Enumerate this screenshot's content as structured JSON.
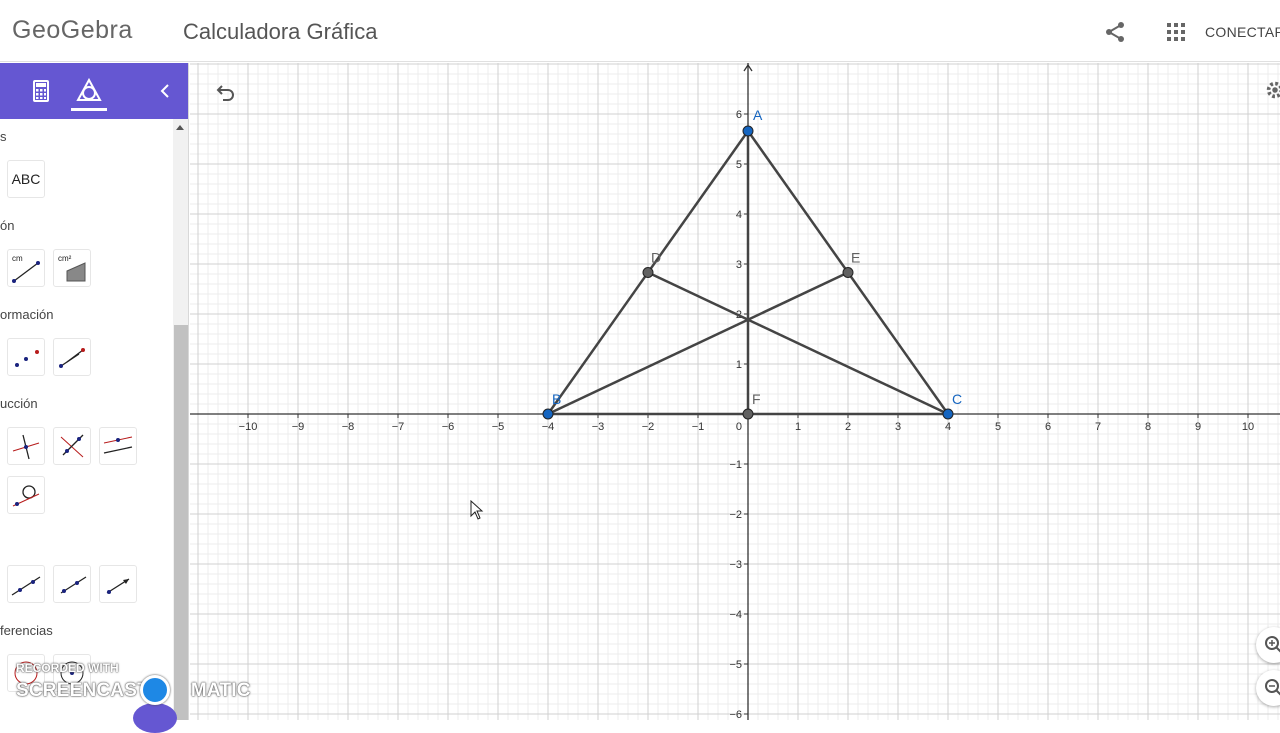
{
  "header": {
    "logo": "GeoGebra",
    "title": "Calculadora Gráfica",
    "connect_label": "CONECTAR",
    "icons": [
      "share-icon",
      "apps-grid-icon"
    ]
  },
  "sidebar": {
    "tabs": [
      "calculator-icon",
      "geometry-tools-icon"
    ],
    "categories": [
      "s",
      "ón",
      "ormación",
      "ucción",
      "ferencias"
    ],
    "tools": {
      "text": "ABC",
      "distance_unit": "cm",
      "area_unit": "cm²"
    }
  },
  "graphics": {
    "x_ticks": [
      "−10",
      "−9",
      "−8",
      "−7",
      "−6",
      "−5",
      "−4",
      "−3",
      "−2",
      "−1",
      "1",
      "2",
      "3",
      "4",
      "5",
      "6",
      "7",
      "8",
      "9",
      "10"
    ],
    "y_ticks": [
      "6",
      "5",
      "4",
      "3",
      "2",
      "1",
      "−1",
      "−2",
      "−3",
      "−4",
      "−5",
      "−6"
    ],
    "origin_label": "0",
    "points": [
      {
        "name": "A",
        "x": 0,
        "y": 5.66,
        "color": "#1565c0"
      },
      {
        "name": "B",
        "x": -4,
        "y": 0,
        "color": "#1565c0"
      },
      {
        "name": "C",
        "x": 4,
        "y": 0,
        "color": "#1565c0"
      },
      {
        "name": "D",
        "x": -2,
        "y": 2.83,
        "color": "#616161"
      },
      {
        "name": "E",
        "x": 2,
        "y": 2.83,
        "color": "#616161"
      },
      {
        "name": "F",
        "x": 0,
        "y": 0,
        "color": "#616161"
      }
    ],
    "segments": [
      [
        "A",
        "B"
      ],
      [
        "B",
        "C"
      ],
      [
        "C",
        "A"
      ],
      [
        "A",
        "F"
      ],
      [
        "B",
        "E"
      ],
      [
        "C",
        "D"
      ]
    ],
    "icons": [
      "undo-icon",
      "settings-icon",
      "zoom-in-icon",
      "zoom-out-icon"
    ]
  },
  "watermark": {
    "line1": "RECORDED WITH",
    "line2": "SCREENCAST",
    "line3": "MATIC"
  },
  "colors": {
    "accent": "#6557d2",
    "point_blue": "#1565c0",
    "point_gray": "#616161",
    "segment": "#444444"
  }
}
